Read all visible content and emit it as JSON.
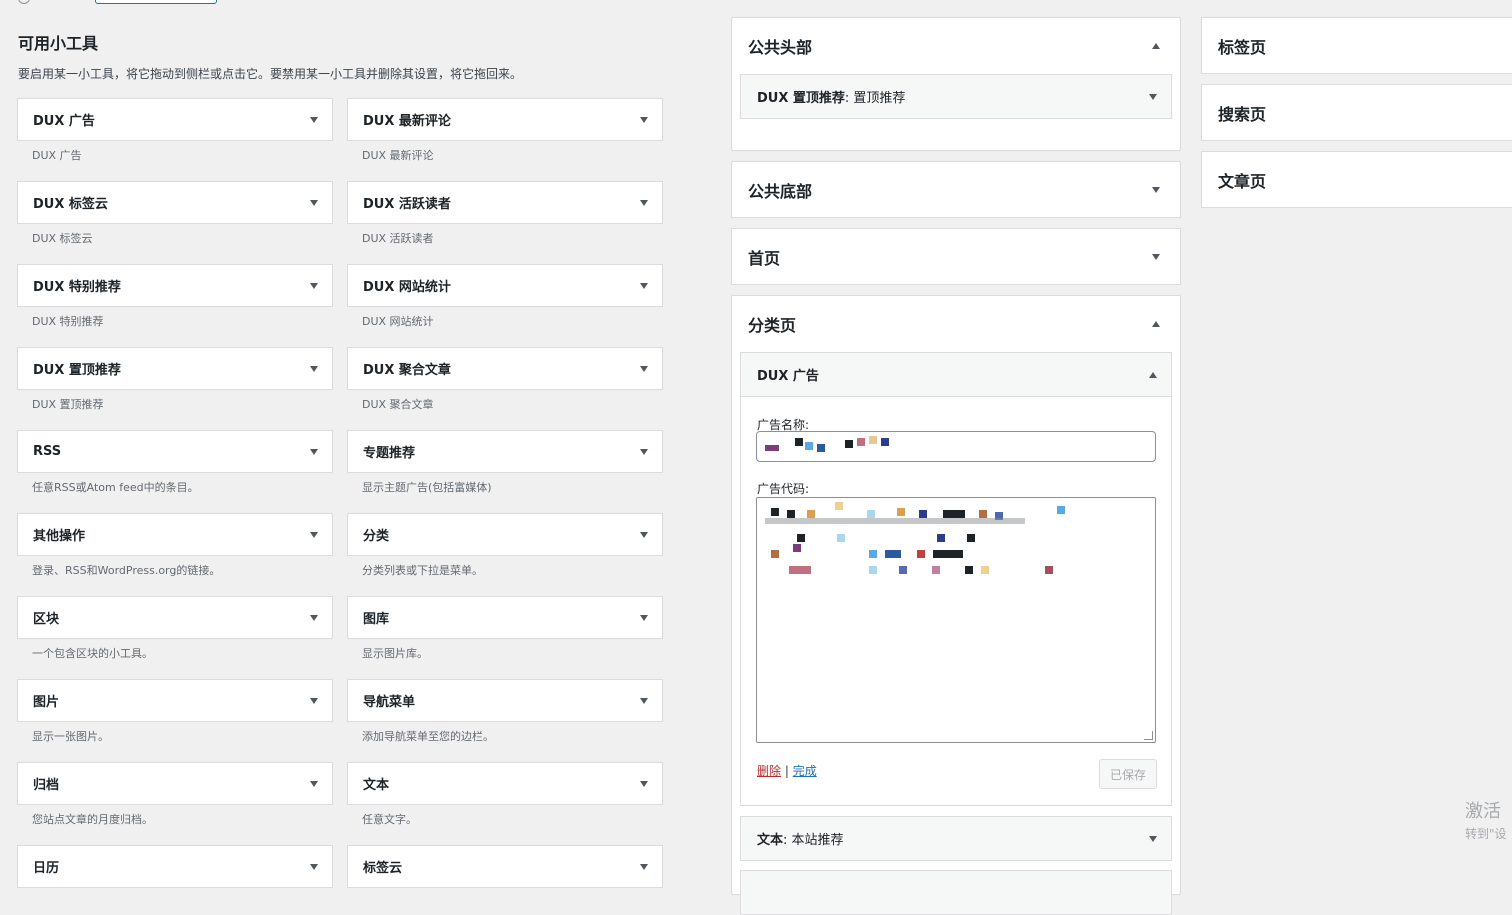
{
  "available": {
    "title": "可用小工具",
    "description": "要启用某一小工具，将它拖动到侧栏或点击它。要禁用某一小工具并删除其设置，将它拖回来。",
    "widgets": [
      {
        "label": "DUX 广告",
        "desc": "DUX 广告"
      },
      {
        "label": "DUX 最新评论",
        "desc": "DUX 最新评论"
      },
      {
        "label": "DUX 标签云",
        "desc": "DUX 标签云"
      },
      {
        "label": "DUX 活跃读者",
        "desc": "DUX 活跃读者"
      },
      {
        "label": "DUX 特别推荐",
        "desc": "DUX 特别推荐"
      },
      {
        "label": "DUX 网站统计",
        "desc": "DUX 网站统计"
      },
      {
        "label": "DUX 置顶推荐",
        "desc": "DUX 置顶推荐"
      },
      {
        "label": "DUX 聚合文章",
        "desc": "DUX 聚合文章"
      },
      {
        "label": "RSS",
        "desc": "任意RSS或Atom feed中的条目。"
      },
      {
        "label": "专题推荐",
        "desc": "显示主题广告(包括富媒体)"
      },
      {
        "label": "其他操作",
        "desc": "登录、RSS和WordPress.org的链接。"
      },
      {
        "label": "分类",
        "desc": "分类列表或下拉是菜单。"
      },
      {
        "label": "区块",
        "desc": "一个包含区块的小工具。"
      },
      {
        "label": "图库",
        "desc": "显示图片库。"
      },
      {
        "label": "图片",
        "desc": "显示一张图片。"
      },
      {
        "label": "导航菜单",
        "desc": "添加导航菜单至您的边栏。"
      },
      {
        "label": "归档",
        "desc": "您站点文章的月度归档。"
      },
      {
        "label": "文本",
        "desc": "任意文字。"
      },
      {
        "label": "日历",
        "desc": ""
      },
      {
        "label": "标签云",
        "desc": ""
      }
    ]
  },
  "sidebars": {
    "header": {
      "title": "公共头部",
      "widget_label": "DUX 置顶推荐",
      "widget_sub": "置顶推荐"
    },
    "footer": {
      "title": "公共底部"
    },
    "home": {
      "title": "首页"
    },
    "category": {
      "title": "分类页",
      "open_widget_label": "DUX 广告",
      "field_name_label": "广告名称:",
      "field_code_label": "广告代码:",
      "delete_link": "删除",
      "separator": "|",
      "done_link": "完成",
      "saved_button": "已保存",
      "next_widget_label": "文本",
      "next_widget_sub": "本站推荐"
    },
    "tags": {
      "title": "标签页"
    },
    "search": {
      "title": "搜索页"
    },
    "article": {
      "title": "文章页"
    }
  },
  "activation": {
    "line1": "激活",
    "line2": "转到\"设"
  },
  "colors": {
    "link": "#2271b1",
    "delete": "#b32d2e",
    "border": "#dcdcde",
    "background": "#f0f0f1"
  }
}
